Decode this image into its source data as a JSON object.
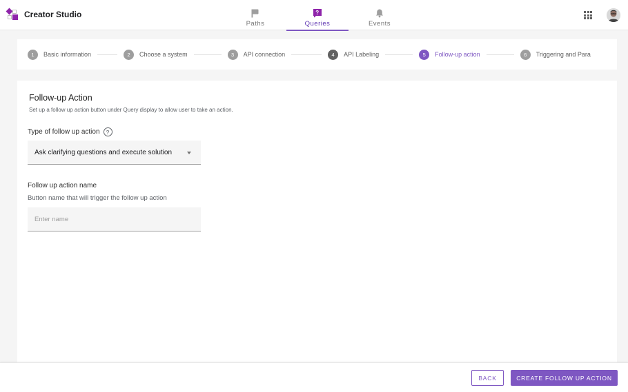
{
  "app": {
    "title": "Creator Studio",
    "logo_icon": "creator-studio-logo-icon"
  },
  "nav": {
    "tabs": [
      {
        "label": "Paths",
        "icon": "flag-icon",
        "active": false
      },
      {
        "label": "Queries",
        "icon": "question-badge-icon",
        "active": true
      },
      {
        "label": "Events",
        "icon": "bell-icon",
        "active": false
      }
    ]
  },
  "header": {
    "apps_icon": "apps-grid-icon",
    "avatar": "user-avatar"
  },
  "stepper": {
    "steps": [
      {
        "num": "1",
        "label": "Basic information",
        "state": "pending"
      },
      {
        "num": "2",
        "label": "Choose a system",
        "state": "pending"
      },
      {
        "num": "3",
        "label": "API connection",
        "state": "pending"
      },
      {
        "num": "4",
        "label": "API Labeling",
        "state": "done"
      },
      {
        "num": "5",
        "label": "Follow-up action",
        "state": "active"
      },
      {
        "num": "6",
        "label": "Triggering and Para",
        "state": "pending"
      }
    ]
  },
  "form": {
    "title": "Follow-up Action",
    "subtitle": "Set up a follow up action button under Query display to allow user to take an action.",
    "type_label": "Type of follow up action",
    "type_value": "Ask clarifying questions and execute solution",
    "name_label": "Follow up action name",
    "name_hint": "Button name that will trigger the follow up action",
    "name_placeholder": "Enter name",
    "name_value": ""
  },
  "footer": {
    "back_label": "BACK",
    "create_label": "CREATE FOLLOW UP ACTION"
  },
  "colors": {
    "accent": "#7e57c2",
    "accent_dark": "#5e35b1",
    "brand": "#8e24aa",
    "step_done": "#616161",
    "step_pending": "#9e9e9e"
  }
}
